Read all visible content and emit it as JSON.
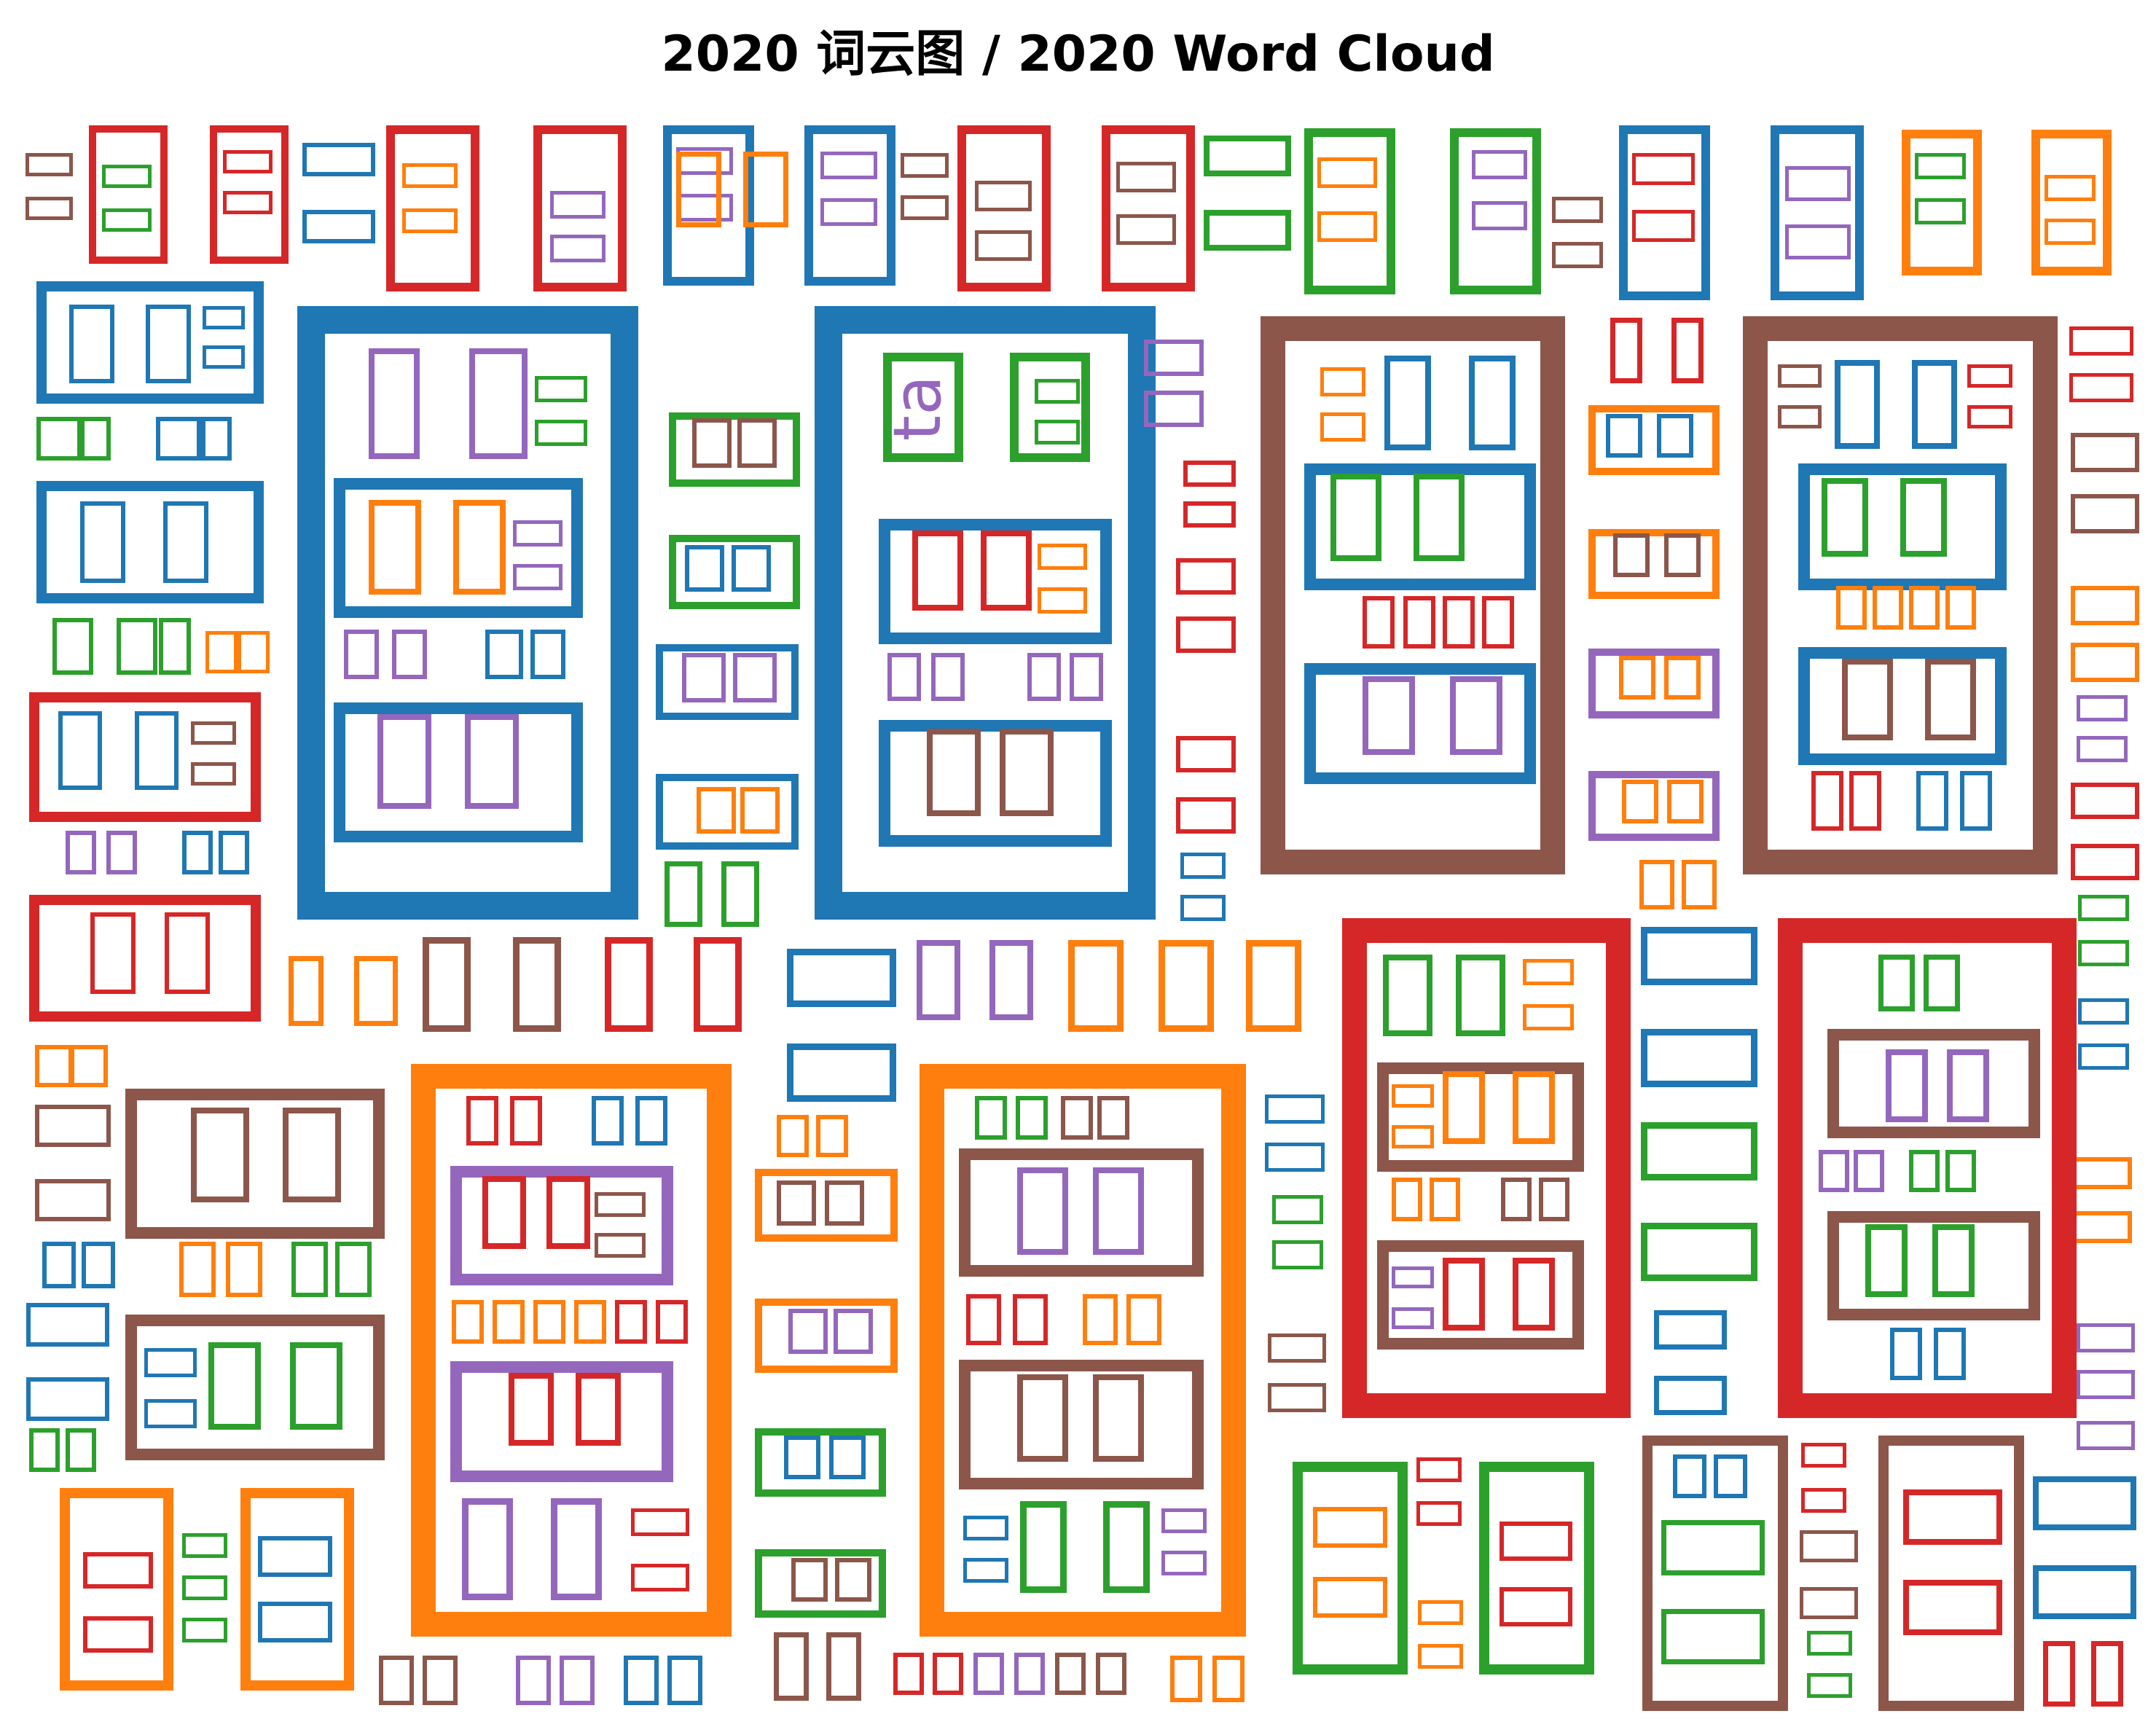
{
  "chart_data": {
    "type": "word-cloud",
    "title": "2020 词云图 / 2020 Word Cloud",
    "colors": [
      "#1f77b4",
      "#ff7f0e",
      "#2ca02c",
      "#d62728",
      "#9467bd",
      "#8c564b"
    ],
    "words": [
      {
        "text": "ta",
        "weight": 3,
        "color": "#9467bd"
      }
    ]
  }
}
